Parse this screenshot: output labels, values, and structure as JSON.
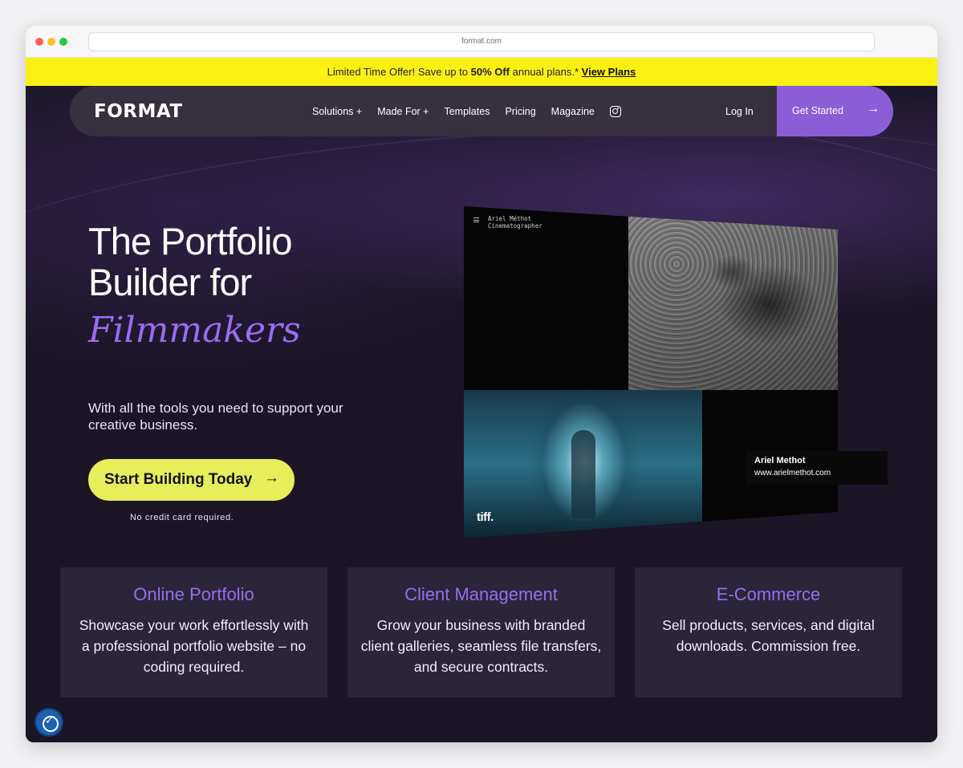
{
  "browser": {
    "url": "format.com"
  },
  "promo": {
    "text": "Limited Time Offer! Save up to ",
    "highlight": "50% Off",
    "suffix": " annual plans.* ",
    "link": "View Plans"
  },
  "nav": {
    "logo": "FORMAT",
    "items": [
      "Solutions +",
      "Made For +",
      "Templates",
      "Pricing",
      "Magazine"
    ],
    "instagram_icon": "instagram-icon",
    "login": "Log In",
    "get_started": "Get Started",
    "arrow": "→"
  },
  "hero": {
    "title_line1": "The Portfolio",
    "title_line2": "Builder for",
    "title_accent": "Filmmakers",
    "subtitle": "With all the tools you need to support your creative business.",
    "cta": "Start Building Today",
    "cta_arrow": "→",
    "note": "No credit card required."
  },
  "mockup": {
    "name": "Ariel Méthot",
    "role": "Cinematographer",
    "brand": "tiff.",
    "card_name": "Ariel Methot",
    "card_url": "www.arielmethot.com"
  },
  "features": [
    {
      "title": "Online Portfolio",
      "body": "Showcase your work effortlessly with a professional portfolio website – no coding  required."
    },
    {
      "title": "Client Management",
      "body": "Grow your business with branded client galleries, seamless file transfers, and secure contracts."
    },
    {
      "title": "E-Commerce",
      "body": "Sell products, services, and digital downloads. Commission free."
    }
  ],
  "colors": {
    "accent": "#9a6cf0",
    "promo_bg": "#fbf011",
    "cta_bg": "#e8ed5a",
    "page_bg": "#1b1526"
  }
}
